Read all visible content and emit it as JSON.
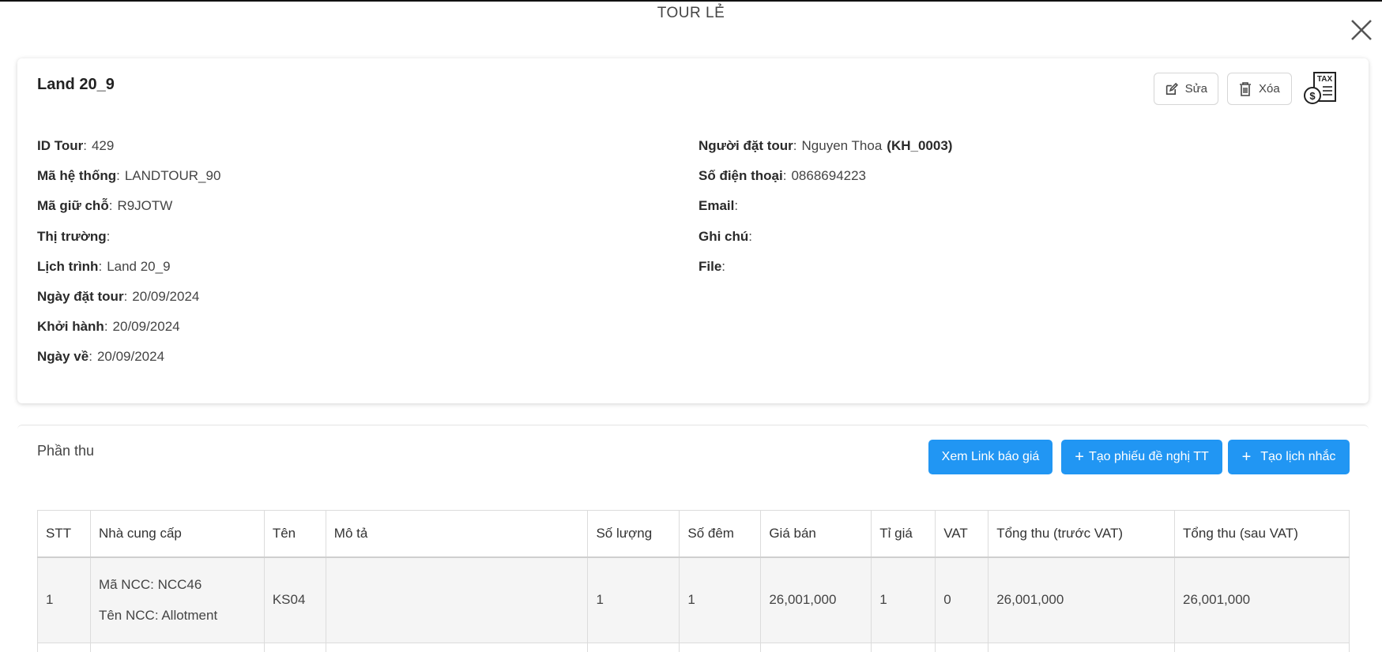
{
  "modal": {
    "title": "TOUR LẺ"
  },
  "tour": {
    "name": "Land 20_9",
    "edit_label": "Sửa",
    "delete_label": "Xóa",
    "tax_label": "TAX"
  },
  "info_left": [
    {
      "label": "ID Tour",
      "value": "429"
    },
    {
      "label": "Mã hệ thống",
      "value": "LANDTOUR_90"
    },
    {
      "label": "Mã giữ chỗ",
      "value": "R9JOTW"
    },
    {
      "label": "Thị trường",
      "value": ""
    },
    {
      "label": "Lịch trình",
      "value": "Land 20_9"
    },
    {
      "label": "Ngày đặt tour",
      "value": "20/09/2024"
    },
    {
      "label": "Khởi hành",
      "value": "20/09/2024"
    },
    {
      "label": "Ngày về",
      "value": "20/09/2024"
    }
  ],
  "info_right": [
    {
      "label": "Người đặt tour",
      "value": "Nguyen Thoa",
      "code": "(KH_0003)"
    },
    {
      "label": "Số điện thoại",
      "value": "0868694223"
    },
    {
      "label": "Email",
      "value": ""
    },
    {
      "label": "Ghi chú",
      "value": ""
    },
    {
      "label": "File",
      "value": ""
    }
  ],
  "receipts": {
    "title": "Phần thu",
    "btn_link": "Xem Link báo giá",
    "btn_phieu": "Tạo phiếu đề nghị TT",
    "btn_nhac": "Tạo lịch nhắc",
    "columns": [
      "STT",
      "Nhà cung cấp",
      "Tên",
      "Mô tả",
      "Số lượng",
      "Số đêm",
      "Giá bán",
      "Tỉ giá",
      "VAT",
      "Tổng thu (trước VAT)",
      "Tổng thu (sau VAT)"
    ],
    "rows": [
      {
        "stt": "1",
        "ncc_code": "Mã NCC: NCC46",
        "ncc_name": "Tên NCC: Allotment",
        "ten": "KS04",
        "mo_ta": "",
        "so_luong": "1",
        "so_dem": "1",
        "gia_ban": "26,001,000",
        "ti_gia": "1",
        "vat": "0",
        "tong_truoc": "26,001,000",
        "tong_sau": "26,001,000"
      }
    ]
  }
}
